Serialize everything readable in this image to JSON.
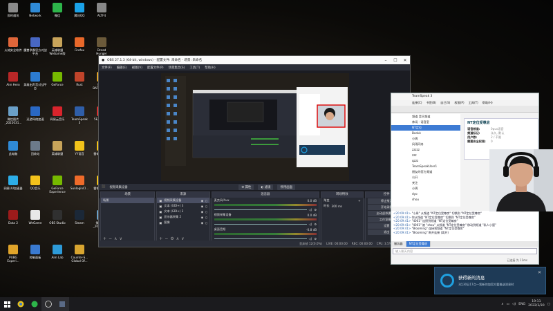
{
  "desktop_icons": [
    {
      "label": "即时通讯",
      "color": "#8a8a8a"
    },
    {
      "label": "火绒安全软件",
      "color": "#e0663a"
    },
    {
      "label": "Aim Hero",
      "color": "#b82727"
    },
    {
      "label": "微信图片\n_2022031...",
      "color": "#6aa0c8"
    },
    {
      "label": "此电脑",
      "color": "#2f8ad6"
    },
    {
      "label": "网易UU加速器",
      "color": "#2daee8"
    },
    {
      "label": "Dota 2",
      "color": "#9c1b1b"
    },
    {
      "label": "PUBG\nExperi...",
      "color": "#e0a42a"
    },
    {
      "label": "Network",
      "color": "#2f8ad6"
    },
    {
      "label": "魔兽争霸官方对战平台",
      "color": "#4867c2"
    },
    {
      "label": "英雄出声音对战平台",
      "color": "#2c7bd0"
    },
    {
      "label": "迅游网络加速",
      "color": "#2a68c4"
    },
    {
      "label": "回收站",
      "color": "#6c7a8a"
    },
    {
      "label": "QQ音乐",
      "color": "#f3c21b"
    },
    {
      "label": "WeGame",
      "color": "#e8e8e8"
    },
    {
      "label": "控制面板",
      "color": "#3a7ad0"
    },
    {
      "label": "微信",
      "color": "#2db54a"
    },
    {
      "label": "英雄联盟\nWeGame版",
      "color": "#c8a45a"
    },
    {
      "label": "GeForce",
      "color": "#76b900"
    },
    {
      "label": "网易云音乐",
      "color": "#d8242c"
    },
    {
      "label": "英雄联盟",
      "color": "#c8a45a"
    },
    {
      "label": "GeForce\nExperience",
      "color": "#76b900"
    },
    {
      "label": "OBS Studio",
      "color": "#303030"
    },
    {
      "label": "Aim Lab",
      "color": "#2d9ad8"
    },
    {
      "label": "腾讯QQ",
      "color": "#1aa2e8"
    },
    {
      "label": "Firefox",
      "color": "#e8682a"
    },
    {
      "label": "Rust",
      "color": "#c0442a"
    },
    {
      "label": "TeamSpeak\n3",
      "color": "#2f5ea8"
    },
    {
      "label": "YY语音",
      "color": "#f2c31a"
    },
    {
      "label": "SunloginCl...",
      "color": "#f06b2a"
    },
    {
      "label": "Steam",
      "color": "#1b2838"
    },
    {
      "label": "Counter-S...\nGlobal Of...",
      "color": "#d8a530"
    },
    {
      "label": "ALTF4",
      "color": "#888888"
    },
    {
      "label": "Dread\nHunger",
      "color": "#6b5a3a"
    },
    {
      "label": "PUBG\nBATTLEGR...",
      "color": "#e0a42a"
    },
    {
      "label": "5E对战平台",
      "color": "#d93232"
    },
    {
      "label": "雷电模拟器4",
      "color": "#f2c21a"
    },
    {
      "label": "雷电多开器4",
      "color": "#f2c21a"
    },
    {
      "label": "微信图片\n_2022030...",
      "color": "#6aa0c8"
    }
  ],
  "obs": {
    "title": "OBS 27.1.3 (64-bit, windows) - 配置文件: 未命名 - 场景: 未命名",
    "menu": [
      "文件(F)",
      "编辑(E)",
      "视图(V)",
      "配置文件(P)",
      "场景集合(S)",
      "工具(T)",
      "帮助(H)"
    ],
    "source_bar": {
      "selected": "视频采集设备",
      "properties": "属性",
      "filters": "滤镜",
      "deactivate": "停用画面"
    },
    "docks": {
      "scenes": "场景",
      "sources": "来源",
      "mixer": "混音器",
      "transitions": "转场特效",
      "controls": "控件"
    },
    "scene_items": [
      "场景"
    ],
    "source_items": [
      "视频采集设备",
      "文本 (GDI+) 3",
      "文本 (GDI+) 2",
      "显示器采集 2",
      "图像"
    ],
    "mixer_channels": [
      {
        "name": "麦克风/Aux",
        "db": "0.0 dB"
      },
      {
        "name": "视频采集设备",
        "db": "0.0 dB"
      },
      {
        "name": "桌面音频",
        "db": "-0.8 dB"
      }
    ],
    "transition": {
      "type": "渐变",
      "duration_label": "时长",
      "duration": "300 ms"
    },
    "controls": [
      "停止推流",
      "开始录制",
      "启动虚拟摄像机",
      "工作室模式",
      "设置",
      "退出"
    ],
    "status": {
      "dropped": "丢弃帧 12(0.0%)",
      "live": "LIVE: 00:00:00",
      "rec": "REC: 00:00:00",
      "cpu": "CPU: 3.5%, 60.00 fps"
    }
  },
  "teamspeak": {
    "title": "TeamSpeak 3",
    "menu": [
      "连接(C)",
      "书签(B)",
      "自己(S)",
      "权限(P)",
      "工具(T)",
      "帮助(H)"
    ],
    "tree": [
      "频道 音乐频道",
      "休闲 · 语音室",
      "NT定位",
      "Bankk",
      "小周",
      "风雨同舟",
      "zzzzz",
      "zzz",
      "qzzz",
      "TeamSpeakUser1",
      "朋友的官方频道",
      "公开",
      "关注",
      "小周",
      "dyo",
      "shou"
    ],
    "info": {
      "heading": "NT定位受尊房",
      "rows": [
        {
          "k": "语音频道:",
          "v": "0pus语音"
        },
        {
          "k": "频道标记:",
          "v": "永久, 默认"
        },
        {
          "k": "用户数:",
          "v": "2 / 不限"
        },
        {
          "k": "需要安全权限:",
          "v": "0"
        }
      ]
    },
    "chat": [
      {
        "time": "<20:09:41>",
        "text": "\"小周\" 从频道 \"NT定位受尊房\" 切换到 \"NT定位受尊房\""
      },
      {
        "time": "<20:09:41>",
        "text": "你从频道 \"NT定位受尊房\" 切换到 \"NT定位受尊房\""
      },
      {
        "time": "<20:09:41>",
        "text": "\"4001\" 连接到频道 \"NT定位受尊房\""
      },
      {
        "time": "<20:09:41>",
        "text": "\"4001\" 被 \"shou\" 从频道 \"NT定位受尊房\" 移动到频道 \"私人小屋\""
      },
      {
        "time": "<20:09:41>",
        "text": "\"Blooming\" 连接到频道 \"NT定位受尊房\""
      },
      {
        "time": "<20:09:41>",
        "text": "\"Blooming\" 断开连接 (离开)"
      }
    ],
    "tabs": [
      "服务器",
      "NT定位受尊房"
    ],
    "input_placeholder": "输入聊天内容",
    "status": "已连接 为 11ms"
  },
  "toast": {
    "title": "获得新的消息",
    "subtitle": "3月30日17点—您新你加官方要推送消息时"
  },
  "taskbar": {
    "time": "19:11",
    "date": "2022/3/30",
    "lang": "ENG"
  }
}
